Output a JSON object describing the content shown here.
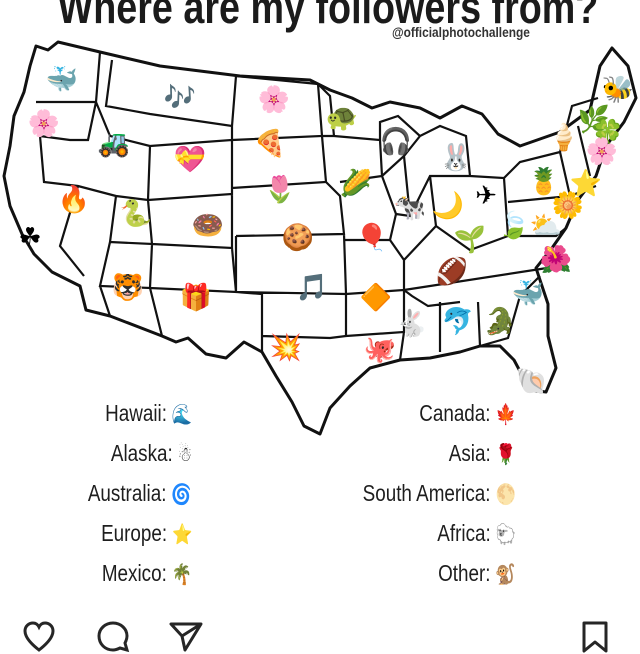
{
  "post": {
    "title": "Where are my followers from?",
    "handle": "@officialphotochallenge"
  },
  "colors": {
    "map_stroke": "#111111",
    "map_fill": "#ffffff",
    "text": "#1e1e1e"
  },
  "states": [
    {
      "name": "washington",
      "emoji": "🐳"
    },
    {
      "name": "oregon",
      "emoji": "🌸"
    },
    {
      "name": "california",
      "emoji": "☘"
    },
    {
      "name": "nevada",
      "emoji": "🔥"
    },
    {
      "name": "idaho",
      "emoji": "🚜"
    },
    {
      "name": "montana",
      "emoji": "🎶"
    },
    {
      "name": "wyoming",
      "emoji": "💝"
    },
    {
      "name": "utah",
      "emoji": "🐍"
    },
    {
      "name": "colorado",
      "emoji": "🍩"
    },
    {
      "name": "arizona",
      "emoji": "🐯"
    },
    {
      "name": "new-mexico",
      "emoji": "🎁"
    },
    {
      "name": "north-dakota",
      "emoji": "🌸"
    },
    {
      "name": "south-dakota",
      "emoji": "🍕"
    },
    {
      "name": "nebraska",
      "emoji": "🌷"
    },
    {
      "name": "kansas",
      "emoji": "🍪"
    },
    {
      "name": "oklahoma",
      "emoji": "🎵"
    },
    {
      "name": "texas",
      "emoji": "💥"
    },
    {
      "name": "minnesota",
      "emoji": "🐢"
    },
    {
      "name": "iowa",
      "emoji": "🌽"
    },
    {
      "name": "missouri",
      "emoji": "🎈"
    },
    {
      "name": "arkansas",
      "emoji": "🔶"
    },
    {
      "name": "louisiana",
      "emoji": "🐙"
    },
    {
      "name": "wisconsin",
      "emoji": "🎧"
    },
    {
      "name": "illinois",
      "emoji": "🐄"
    },
    {
      "name": "michigan",
      "emoji": "🐰"
    },
    {
      "name": "indiana",
      "emoji": "🌙"
    },
    {
      "name": "ohio",
      "emoji": "✈"
    },
    {
      "name": "kentucky",
      "emoji": "🌱"
    },
    {
      "name": "tennessee",
      "emoji": "🏈"
    },
    {
      "name": "mississippi",
      "emoji": "🐇"
    },
    {
      "name": "alabama",
      "emoji": "🐬"
    },
    {
      "name": "georgia",
      "emoji": "🐊"
    },
    {
      "name": "florida",
      "emoji": "🐚"
    },
    {
      "name": "south-carolina",
      "emoji": "🐳"
    },
    {
      "name": "north-carolina",
      "emoji": "🌺"
    },
    {
      "name": "virginia",
      "emoji": "⛅"
    },
    {
      "name": "west-virginia",
      "emoji": "🍃"
    },
    {
      "name": "pennsylvania",
      "emoji": "🍍"
    },
    {
      "name": "new-york",
      "emoji": "🍦"
    },
    {
      "name": "maine",
      "emoji": "🐝"
    },
    {
      "name": "vermont",
      "emoji": "🌿"
    },
    {
      "name": "new-hampshire",
      "emoji": "🍀"
    },
    {
      "name": "massachusetts",
      "emoji": "🌸"
    },
    {
      "name": "new-jersey",
      "emoji": "⭐"
    },
    {
      "name": "maryland",
      "emoji": "🌼"
    }
  ],
  "legend": {
    "left": [
      {
        "label": "Hawaii:",
        "icon": "🌊"
      },
      {
        "label": "Alaska:",
        "icon": "☃"
      },
      {
        "label": "Australia:",
        "icon": "🌀"
      },
      {
        "label": "Europe:",
        "icon": "⭐"
      },
      {
        "label": "Mexico:",
        "icon": "🌴"
      }
    ],
    "right": [
      {
        "label": "Canada:",
        "icon": "🍁"
      },
      {
        "label": "Asia:",
        "icon": "🌹"
      },
      {
        "label": "South America:",
        "icon": "🌕"
      },
      {
        "label": "Africa:",
        "icon": "🐑"
      },
      {
        "label": "Other:",
        "icon": "🐒"
      }
    ]
  },
  "actions": {
    "like_icon": "heart-icon",
    "comment_icon": "comment-icon",
    "share_icon": "send-icon",
    "save_icon": "bookmark-icon"
  }
}
